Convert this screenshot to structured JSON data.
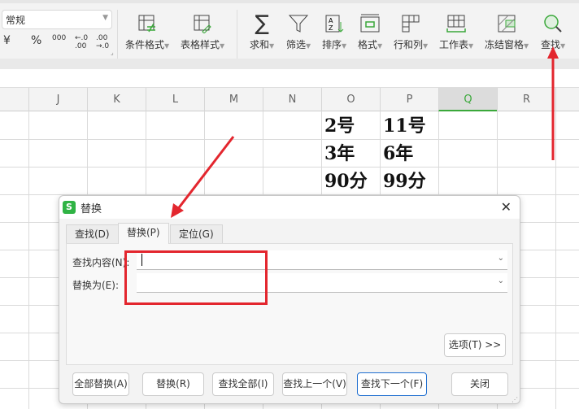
{
  "toolbar": {
    "number_format": "常规",
    "number_buttons": [
      "¥",
      "%",
      "000",
      "←.0 .00",
      ".00 →.0"
    ],
    "items": [
      {
        "label": "条件格式",
        "icon": "conditional-format-icon"
      },
      {
        "label": "表格样式",
        "icon": "table-style-icon"
      },
      {
        "label": "求和",
        "icon": "sum-icon"
      },
      {
        "label": "筛选",
        "icon": "filter-icon"
      },
      {
        "label": "排序",
        "icon": "sort-icon"
      },
      {
        "label": "格式",
        "icon": "format-icon"
      },
      {
        "label": "行和列",
        "icon": "rows-columns-icon"
      },
      {
        "label": "工作表",
        "icon": "worksheet-icon"
      },
      {
        "label": "冻结窗格",
        "icon": "freeze-panes-icon"
      },
      {
        "label": "查找",
        "icon": "search-icon"
      }
    ]
  },
  "sheet": {
    "columns": [
      "J",
      "K",
      "L",
      "M",
      "N",
      "O",
      "P",
      "Q",
      "R"
    ],
    "selected_column": "Q",
    "cells": [
      [
        "2号",
        "11号"
      ],
      [
        "3年",
        "6年"
      ],
      [
        "90分",
        "99分"
      ]
    ]
  },
  "dialog": {
    "title": "替换",
    "tabs": [
      "查找(D)",
      "替换(P)",
      "定位(G)"
    ],
    "active_tab": "替换(P)",
    "find_label": "查找内容(N):",
    "find_value": "",
    "replace_label": "替换为(E):",
    "replace_value": "",
    "options_button": "选项(T) >>",
    "buttons": [
      "全部替换(A)",
      "替换(R)",
      "查找全部(I)",
      "查找上一个(V)",
      "查找下一个(F)",
      "关闭"
    ]
  },
  "colors": {
    "accent": "#2fb344",
    "annotation": "#e3262e",
    "primary_border": "#1f6fd0"
  }
}
